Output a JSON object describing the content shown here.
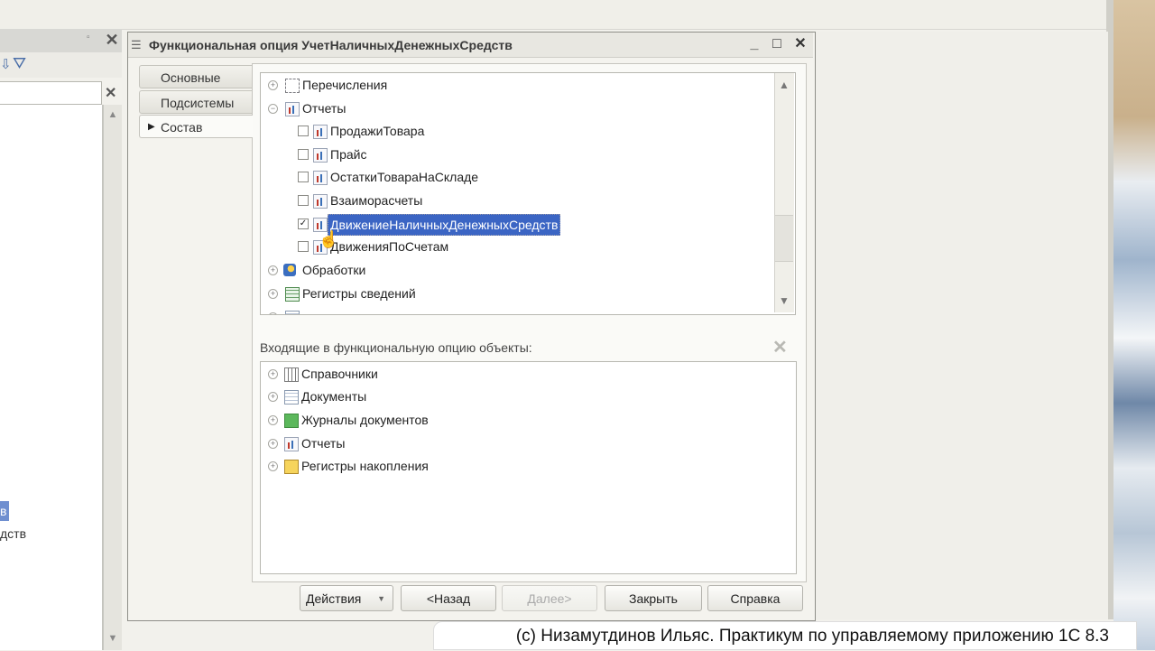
{
  "window": {
    "title": "Функциональная опция УчетНаличныхДенежныхСредств",
    "controls": {
      "minimize": "_",
      "maximize": "□",
      "close": "✕"
    }
  },
  "tabs": [
    {
      "label": "Основные"
    },
    {
      "label": "Подсистемы"
    },
    {
      "label": "Состав"
    }
  ],
  "metadata_tree": {
    "items": [
      {
        "label": "Перечисления",
        "icon": "enum-icon",
        "expander": "plus"
      },
      {
        "label": "Отчеты",
        "icon": "report-icon",
        "expander": "minus"
      },
      {
        "label": "ПродажиТовара",
        "icon": "report-icon",
        "checked": false
      },
      {
        "label": "Прайс",
        "icon": "report-icon",
        "checked": false
      },
      {
        "label": "ОстаткиТовараНаСкладе",
        "icon": "report-icon",
        "checked": false
      },
      {
        "label": "Взаиморасчеты",
        "icon": "report-icon",
        "checked": false
      },
      {
        "label": "ДвижениеНаличныхДенежныхСредств",
        "icon": "report-icon",
        "checked": true,
        "selected": true
      },
      {
        "label": "ДвиженияПоСчетам",
        "icon": "report-icon",
        "checked": false
      },
      {
        "label": "Обработки",
        "icon": "data-processor-icon",
        "expander": "plus"
      },
      {
        "label": "Регистры сведений",
        "icon": "info-register-icon",
        "expander": "plus"
      }
    ]
  },
  "included": {
    "label": "Входящие в функциональную опцию объекты:",
    "items": [
      {
        "label": "Справочники",
        "icon": "catalog-icon"
      },
      {
        "label": "Документы",
        "icon": "document-icon"
      },
      {
        "label": "Журналы документов",
        "icon": "journal-icon"
      },
      {
        "label": "Отчеты",
        "icon": "report-icon"
      },
      {
        "label": "Регистры накопления",
        "icon": "accumulation-register-icon"
      }
    ]
  },
  "buttons": {
    "actions": "Действия",
    "back": "<Назад",
    "next": "Далее>",
    "close": "Закрыть",
    "help": "Справка"
  },
  "left_panel": {
    "selected_fragment": "в",
    "item_fragment": "дств"
  },
  "watermark": "(c) Низамутдинов Ильяс. Практикум по управляемому приложению 1С 8.3"
}
